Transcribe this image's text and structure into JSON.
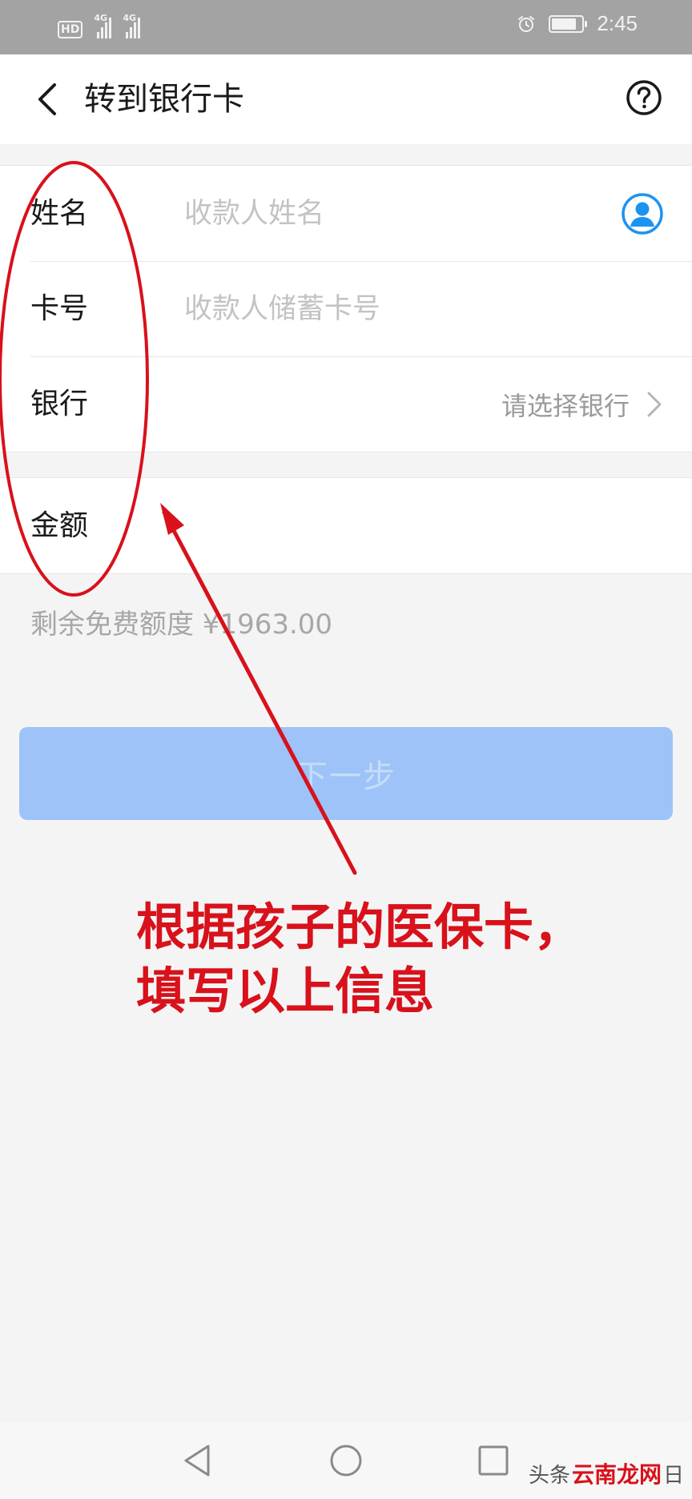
{
  "status_bar": {
    "hd_label": "HD",
    "sim1_tag": "4G",
    "sim2_tag": "4G",
    "battery_level": 0.85,
    "time": "2:45"
  },
  "nav": {
    "title": "转到银行卡"
  },
  "form": {
    "name_label": "姓名",
    "name_placeholder": "收款人姓名",
    "card_label": "卡号",
    "card_placeholder": "收款人储蓄卡号",
    "bank_label": "银行",
    "bank_placeholder": "请选择银行",
    "amount_label": "金额"
  },
  "quota_text": "剩余免费额度 ¥1963.00",
  "next_button_label": "下一步",
  "annotation": {
    "text": "根据孩子的医保卡，\n填写以上信息",
    "color": "#d8111b"
  },
  "watermark": {
    "prefix": "头条",
    "brand": "云南龙网",
    "suffix": "日"
  },
  "colors": {
    "primary_disabled": "#9dc3f8",
    "contact_icon": "#1d93f0",
    "annotation_red": "#d8111b"
  }
}
